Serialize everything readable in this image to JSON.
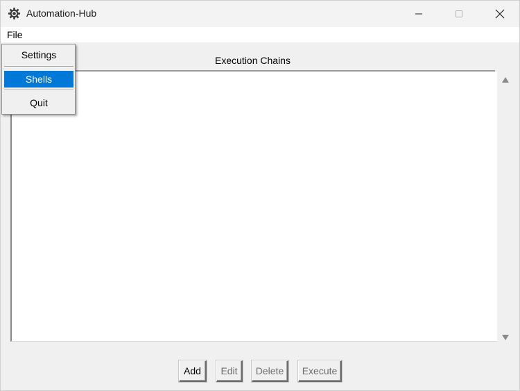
{
  "window": {
    "title": "Automation-Hub",
    "icon": "gear-icon"
  },
  "menubar": {
    "file_label": "File"
  },
  "file_menu": {
    "items": [
      {
        "label": "Settings",
        "highlighted": false
      },
      {
        "label": "Shells",
        "highlighted": true
      },
      {
        "label": "Quit",
        "highlighted": false
      }
    ],
    "highlight_color": "#0078d7"
  },
  "list": {
    "header": "Execution Chains",
    "items": []
  },
  "buttons": {
    "add": "Add",
    "edit": "Edit",
    "delete": "Delete",
    "execute": "Execute"
  }
}
